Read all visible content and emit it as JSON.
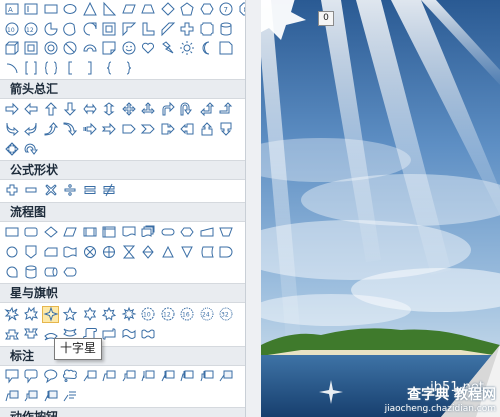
{
  "gallery": {
    "categories": {
      "arrows": "箭头总汇",
      "equation": "公式形状",
      "flowchart": "流程图",
      "stars": "星与旗帜",
      "callouts": "标注",
      "action": "动作按钮"
    },
    "selected_shape": "十字星"
  },
  "tooltip": {
    "text": "十字星"
  },
  "canvas": {
    "rotation_label": "0",
    "watermark_site": "jb51.net",
    "watermark_main": "查字典 教程网",
    "watermark_sub": "jiaocheng.chazidian.com",
    "colors": {
      "sky_top": "#2c5c95",
      "sky_mid": "#7aa5cf",
      "sea": "#1d4e86",
      "island": "#3f7a2c"
    }
  }
}
